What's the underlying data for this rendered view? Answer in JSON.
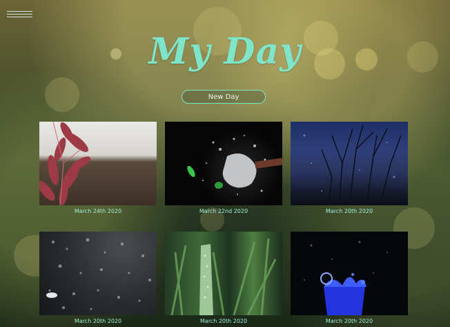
{
  "header": {
    "title": "My Day",
    "new_day_label": "New Day"
  },
  "cards": [
    {
      "date": "March 24th 2020",
      "image": "red-leaves-photo"
    },
    {
      "date": "March 22nd 2020",
      "image": "water-balloon-splash-photo"
    },
    {
      "date": "March 20th 2020",
      "image": "rainy-window-branches-photo"
    },
    {
      "date": "March 20th 2020",
      "image": "water-drops-dark-surface-photo"
    },
    {
      "date": "March 20th 2020",
      "image": "dewy-grass-photo"
    },
    {
      "date": "March 20th 2020",
      "image": "blue-liquid-splash-photo"
    }
  ],
  "colors": {
    "accent": "#7fe5c9",
    "date_text": "#9feedb",
    "menu_lines": "#cde8df"
  }
}
